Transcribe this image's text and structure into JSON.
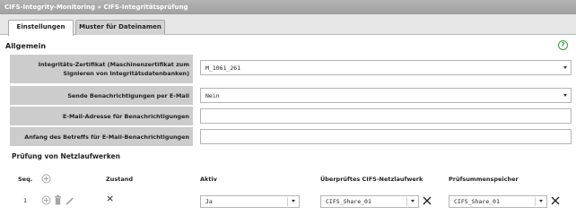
{
  "breadcrumb": {
    "parent": "CIFS-Integrity-Monitoring",
    "separator": "»",
    "current": "CIFS-Integritätsprüfung"
  },
  "tabs": [
    {
      "label": "Einstellungen",
      "active": true
    },
    {
      "label": "Muster für Dateinamen",
      "active": false
    }
  ],
  "general": {
    "title": "Allgemein",
    "help_icon": "question-circle-icon",
    "help_glyph": "?",
    "fields": [
      {
        "label_line1": "Integritäts-Zertifikat (Maschinenzertifikat zum",
        "label_line2": "Signieren von Integritätsdatenbanken)",
        "value": "M_1061_261",
        "type": "dropdown"
      },
      {
        "label": "Sende Benachrichtigungen per E-Mail",
        "value": "Nein",
        "type": "dropdown"
      },
      {
        "label": "E-Mail-Adresse für Benachrichtigungen",
        "value": "",
        "type": "text"
      },
      {
        "label": "Anfang des Betreffs für E-Mail-Benachrichtigungen",
        "value": "",
        "type": "text"
      }
    ]
  },
  "checks": {
    "title": "Prüfung von Netzlaufwerken",
    "columns": {
      "seq": "Seq.",
      "state": "Zustand",
      "active": "Aktiv",
      "share": "Überprüftes CIFS-Netzlaufwerk",
      "checksum": "Prüfsummenspeicher"
    },
    "rows": [
      {
        "seq": "1",
        "state": "×",
        "active": "Ja",
        "share": "CIFS_Share_01",
        "checksum": "CIFS_Share_01"
      }
    ]
  },
  "glyphs": {
    "add": "⊕",
    "delete": "🗑",
    "edit": "✎",
    "remove": "✕"
  },
  "colors": {
    "title_bar": "#a8a8a8",
    "label_bg": "#cccccc",
    "help_green": "#3a9a3a"
  }
}
